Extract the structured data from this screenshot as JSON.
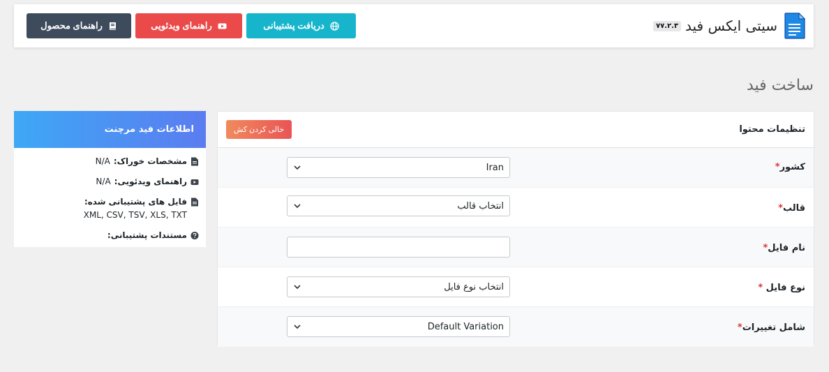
{
  "header": {
    "title": "سیتی ایکس فید",
    "version": "۷۷.۲.۳",
    "buttons": {
      "product_guide": "راهنمای محصول",
      "video_guide": "راهنمای ویدئویی",
      "get_support": "دریافت پشتیبانی"
    },
    "colors": {
      "product_guide": "#3d4b5c",
      "video_guide": "#ea4a4a",
      "get_support": "#17b5cc"
    }
  },
  "page_title": "ساخت فید",
  "panel": {
    "title": "تنظیمات محتوا",
    "clear_cache_label": "خالی کردن کش",
    "fields": [
      {
        "label": "کشور",
        "required_mark": "*",
        "value": "Iran"
      },
      {
        "label": "قالب",
        "required_mark": "*",
        "value": "انتخاب قالب"
      },
      {
        "label": "نام فایل",
        "required_mark": "*",
        "value": ""
      },
      {
        "label": "نوع فایل ",
        "required_mark": "*",
        "value": "انتخاب نوع فایل"
      },
      {
        "label": "شامل تغییرات",
        "required_mark": "*",
        "value": "Default Variation"
      }
    ]
  },
  "info_card": {
    "title": "اطلاعات فید مرچنت",
    "items": [
      {
        "label": "مشخصات خوراک:",
        "value": "N/A",
        "icon": "file-icon"
      },
      {
        "label": "راهنمای ویدئویی:",
        "value": "N/A",
        "icon": "youtube-icon"
      },
      {
        "label": "فایل های پشتیبانی شده:",
        "value": "XML, CSV, TSV, XLS, TXT",
        "icon": "file-icon"
      },
      {
        "label": "مستندات پشتیبانی:",
        "value": "",
        "icon": "question-circle-icon"
      }
    ]
  }
}
